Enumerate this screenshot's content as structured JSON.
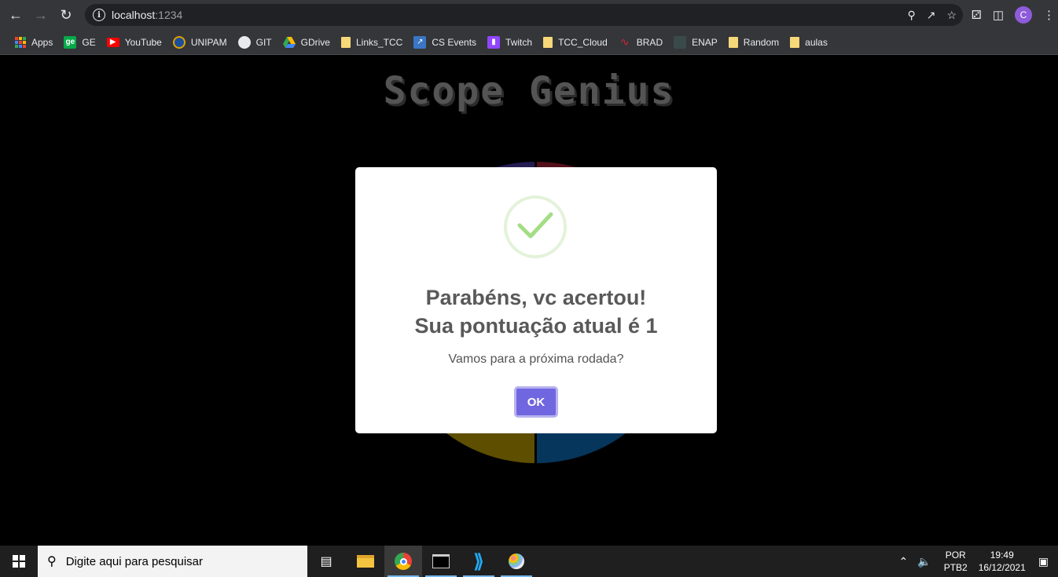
{
  "browser": {
    "url_host": "localhost",
    "url_port": ":1234",
    "profile_initial": "C",
    "bookmarks": [
      {
        "label": "Apps",
        "icon": "apps-grid-icon"
      },
      {
        "label": "GE",
        "icon": "ge-icon"
      },
      {
        "label": "YouTube",
        "icon": "youtube-icon"
      },
      {
        "label": "UNIPAM",
        "icon": "unipam-icon"
      },
      {
        "label": "GIT",
        "icon": "github-icon"
      },
      {
        "label": "GDrive",
        "icon": "gdrive-icon"
      },
      {
        "label": "Links_TCC",
        "icon": "folder-icon"
      },
      {
        "label": "CS Events",
        "icon": "cs-events-icon"
      },
      {
        "label": "Twitch",
        "icon": "twitch-icon"
      },
      {
        "label": "TCC_Cloud",
        "icon": "folder-icon"
      },
      {
        "label": "BRAD",
        "icon": "brad-icon"
      },
      {
        "label": "ENAP",
        "icon": "enap-icon"
      },
      {
        "label": "Random",
        "icon": "folder-icon"
      },
      {
        "label": "aulas",
        "icon": "folder-icon"
      }
    ]
  },
  "page": {
    "title": "Scope Genius",
    "colors": {
      "top_left": "#3d2f8a",
      "top_right": "#8a1a2c",
      "bottom_left": "#9c8300",
      "bottom_right": "#0a5a9a"
    }
  },
  "modal": {
    "icon": "success-check-icon",
    "title_line1": "Parabéns, vc acertou!",
    "title_line2": "Sua pontuação atual é 1",
    "text": "Vamos para a próxima rodada?",
    "ok_label": "OK",
    "accent": "#7066e0"
  },
  "taskbar": {
    "search_placeholder": "Digite aqui para pesquisar",
    "lang_top": "POR",
    "lang_bottom": "PTB2",
    "time": "19:49",
    "date": "16/12/2021"
  }
}
